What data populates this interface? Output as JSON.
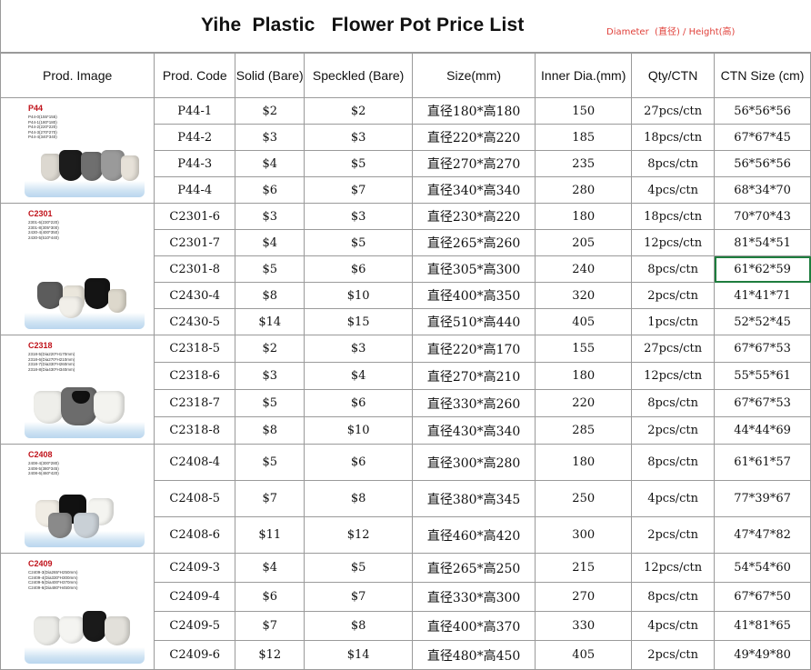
{
  "title": "Yihe  Plastic   Flower Pot Price List",
  "subtitle": "Diameter  (直径) / Height(高)",
  "headers": [
    "Prod. Image",
    "Prod. Code",
    "Solid (Bare)",
    "Speckled (Bare)",
    "Size(mm)",
    "Inner Dia.(mm)",
    "Qty/CTN",
    "CTN Size (cm)"
  ],
  "groups": [
    {
      "brand": "P44",
      "specs": [
        "P44-0(155*155)",
        "P44-1(180*180)",
        "P44-2(220*220)",
        "P44-3(270*270)",
        "P44-4(340*340)"
      ],
      "rows": [
        {
          "code": "P44-1",
          "solid": "$2",
          "speckled": "$2",
          "size": "直径180*高180",
          "inner": "150",
          "qty": "27pcs/ctn",
          "ctn": "56*56*56"
        },
        {
          "code": "P44-2",
          "solid": "$3",
          "speckled": "$3",
          "size": "直径220*高220",
          "inner": "185",
          "qty": "18pcs/ctn",
          "ctn": "67*67*45"
        },
        {
          "code": "P44-3",
          "solid": "$4",
          "speckled": "$5",
          "size": "直径270*高270",
          "inner": "235",
          "qty": "8pcs/ctn",
          "ctn": "56*56*56"
        },
        {
          "code": "P44-4",
          "solid": "$6",
          "speckled": "$7",
          "size": "直径340*高340",
          "inner": "280",
          "qty": "4pcs/ctn",
          "ctn": "68*34*70"
        }
      ]
    },
    {
      "brand": "C2301",
      "specs": [
        "2301-6(230*220)",
        "2301-8(305*300)",
        "2430-4(400*350)",
        "2430-5(510*440)"
      ],
      "rows": [
        {
          "code": "C2301-6",
          "solid": "$3",
          "speckled": "$3",
          "size": "直径230*高220",
          "inner": "180",
          "qty": "18pcs/ctn",
          "ctn": "70*70*43"
        },
        {
          "code": "C2301-7",
          "solid": "$4",
          "speckled": "$5",
          "size": "直径265*高260",
          "inner": "205",
          "qty": "12pcs/ctn",
          "ctn": "81*54*51"
        },
        {
          "code": "C2301-8",
          "solid": "$5",
          "speckled": "$6",
          "size": "直径305*高300",
          "inner": "240",
          "qty": "8pcs/ctn",
          "ctn": "61*62*59"
        },
        {
          "code": "C2430-4",
          "solid": "$8",
          "speckled": "$10",
          "size": "直径400*高350",
          "inner": "320",
          "qty": "2pcs/ctn",
          "ctn": "41*41*71"
        },
        {
          "code": "C2430-5",
          "solid": "$14",
          "speckled": "$15",
          "size": "直径510*高440",
          "inner": "405",
          "qty": "1pcs/ctn",
          "ctn": "52*52*45"
        }
      ]
    },
    {
      "brand": "C2318",
      "specs": [
        "2318-5(Dia220*H170mm)",
        "2318-6(Dia270*H210mm)",
        "2318-7(Dia330*H260mm)",
        "2318-8(Dia430*H340mm)"
      ],
      "rows": [
        {
          "code": "C2318-5",
          "solid": "$2",
          "speckled": "$3",
          "size": "直径220*高170",
          "inner": "155",
          "qty": "27pcs/ctn",
          "ctn": "67*67*53"
        },
        {
          "code": "C2318-6",
          "solid": "$3",
          "speckled": "$4",
          "size": "直径270*高210",
          "inner": "180",
          "qty": "12pcs/ctn",
          "ctn": "55*55*61"
        },
        {
          "code": "C2318-7",
          "solid": "$5",
          "speckled": "$6",
          "size": "直径330*高260",
          "inner": "220",
          "qty": "8pcs/ctn",
          "ctn": "67*67*53"
        },
        {
          "code": "C2318-8",
          "solid": "$8",
          "speckled": "$10",
          "size": "直径430*高340",
          "inner": "285",
          "qty": "2pcs/ctn",
          "ctn": "44*44*69"
        }
      ]
    },
    {
      "brand": "C2408",
      "specs": [
        "2408-4(300*280)",
        "2408-5(380*345)",
        "2408-6(460*420)"
      ],
      "rows": [
        {
          "code": "C2408-4",
          "solid": "$5",
          "speckled": "$6",
          "size": "直径300*高280",
          "inner": "180",
          "qty": "8pcs/ctn",
          "ctn": "61*61*57"
        },
        {
          "code": "C2408-5",
          "solid": "$7",
          "speckled": "$8",
          "size": "直径380*高345",
          "inner": "250",
          "qty": "4pcs/ctn",
          "ctn": "77*39*67"
        },
        {
          "code": "C2408-6",
          "solid": "$11",
          "speckled": "$12",
          "size": "直径460*高420",
          "inner": "300",
          "qty": "2pcs/ctn",
          "ctn": "47*47*82"
        }
      ]
    },
    {
      "brand": "C2409",
      "specs": [
        "C2409-3(Dia265*H250mm)",
        "C2409-4(Dia330*H300mm)",
        "C2409-5(Dia400*H370mm)",
        "C2409-6(Dia480*H450mm)"
      ],
      "rows": [
        {
          "code": "C2409-3",
          "solid": "$4",
          "speckled": "$5",
          "size": "直径265*高250",
          "inner": "215",
          "qty": "12pcs/ctn",
          "ctn": "54*54*60"
        },
        {
          "code": "C2409-4",
          "solid": "$6",
          "speckled": "$7",
          "size": "直径330*高300",
          "inner": "270",
          "qty": "8pcs/ctn",
          "ctn": "67*67*50"
        },
        {
          "code": "C2409-5",
          "solid": "$7",
          "speckled": "$8",
          "size": "直径400*高370",
          "inner": "330",
          "qty": "4pcs/ctn",
          "ctn": "41*81*65"
        },
        {
          "code": "C2409-6",
          "solid": "$12",
          "speckled": "$14",
          "size": "直径480*高450",
          "inner": "405",
          "qty": "2pcs/ctn",
          "ctn": "49*49*80"
        }
      ]
    }
  ],
  "selected_cell": "C2301-8",
  "colors": {
    "brand_text": "#c0121a",
    "subtitle": "#e0403a",
    "grid": "#9a9a9a",
    "selection": "#1e7d3e"
  }
}
